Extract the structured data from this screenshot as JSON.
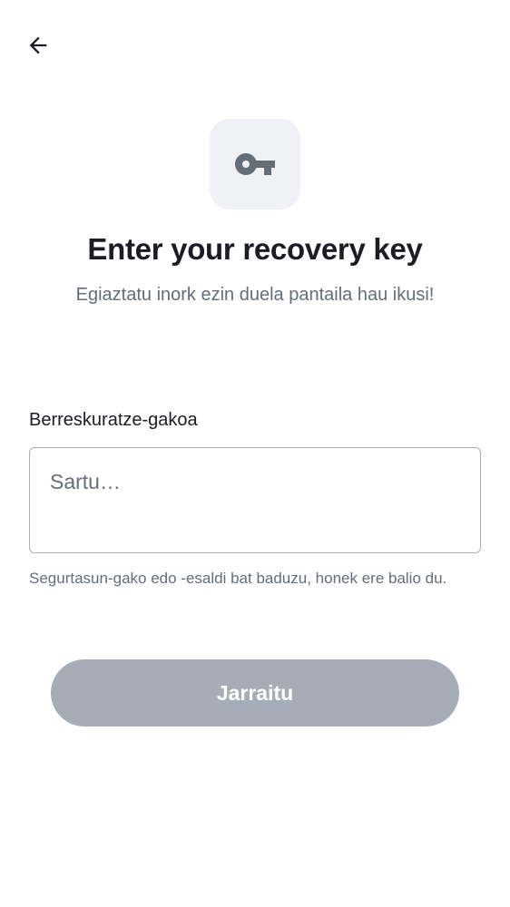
{
  "header": {
    "back_icon": "arrow-left-icon"
  },
  "hero": {
    "icon": "key-icon",
    "title": "Enter your recovery key",
    "subtitle": "Egiaztatu inork ezin duela pantaila hau ikusi!"
  },
  "form": {
    "label": "Berreskuratze-gakoa",
    "input_value": "",
    "placeholder": "Sartu…",
    "helper": "Segurtasun-gako edo -esaldi bat baduzu, honek ere balio du."
  },
  "actions": {
    "continue_label": "Jarraitu",
    "continue_enabled": false
  },
  "colors": {
    "text_primary": "#1b1d22",
    "text_secondary": "#656d77",
    "icon_tile_bg": "#f0f1f5",
    "button_disabled_bg": "#a7adb7",
    "input_border": "#a8adb4"
  }
}
